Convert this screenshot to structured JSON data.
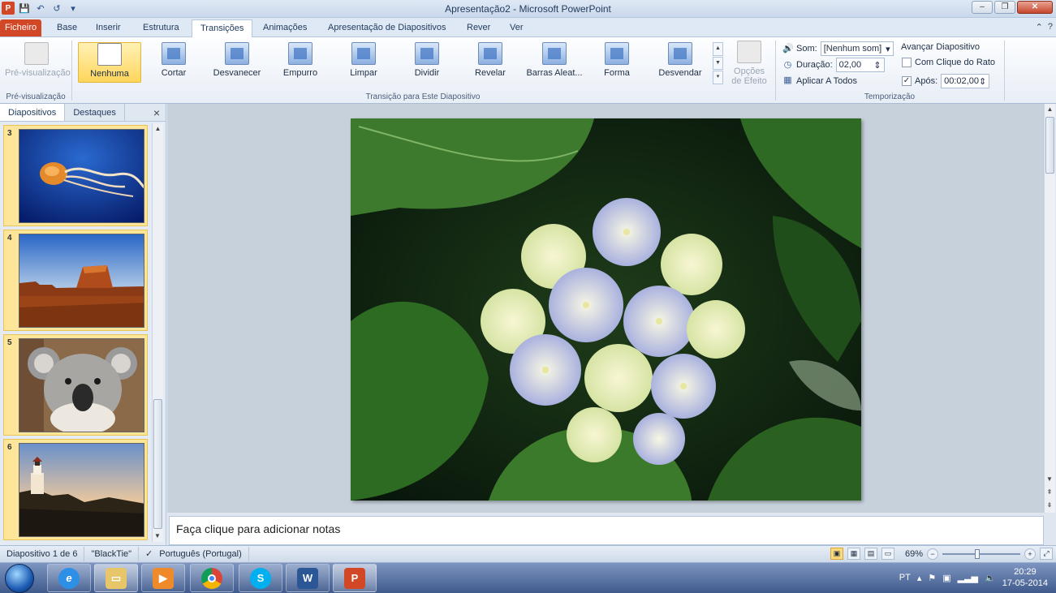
{
  "window": {
    "title": "Apresentação2 - Microsoft PowerPoint",
    "minimize": "–",
    "restore": "❐",
    "close": "✕"
  },
  "quick_access": {
    "app_icon": "P",
    "save_icon": "💾",
    "undo_icon": "↶",
    "repeat_icon": "↺",
    "customize_icon": "▾"
  },
  "tabs": [
    {
      "label": "Ficheiro"
    },
    {
      "label": "Base"
    },
    {
      "label": "Inserir"
    },
    {
      "label": "Estrutura"
    },
    {
      "label": "Transições"
    },
    {
      "label": "Animações"
    },
    {
      "label": "Apresentação de Diapositivos"
    },
    {
      "label": "Rever"
    },
    {
      "label": "Ver"
    }
  ],
  "tab_right": {
    "collapse_icon": "⌃",
    "help_icon": "?"
  },
  "ribbon": {
    "preview": {
      "label": "Pré-visualização",
      "group_label": "Pré-visualização"
    },
    "transitions": [
      {
        "label": "Nenhuma"
      },
      {
        "label": "Cortar"
      },
      {
        "label": "Desvanecer"
      },
      {
        "label": "Empurro"
      },
      {
        "label": "Limpar"
      },
      {
        "label": "Dividir"
      },
      {
        "label": "Revelar"
      },
      {
        "label": "Barras Aleat..."
      },
      {
        "label": "Forma"
      },
      {
        "label": "Desvendar"
      }
    ],
    "transitions_group_label": "Transição para Este Diapositivo",
    "effect_options": {
      "label1": "Opções",
      "label2": "de Efeito"
    },
    "timing": {
      "sound_label": "Som:",
      "sound_value": "[Nenhum som]",
      "duration_label": "Duração:",
      "duration_value": "02,00",
      "apply_all_label": "Aplicar A Todos",
      "advance_title": "Avançar Diapositivo",
      "on_click_label": "Com Clique do Rato",
      "after_label": "Após:",
      "after_value": "00:02,00",
      "group_label": "Temporização"
    }
  },
  "slides_pane": {
    "tab_slides": "Diapositivos",
    "tab_outline": "Destaques",
    "close": "×",
    "thumbs": [
      {
        "num": "3",
        "subject": "jellyfish"
      },
      {
        "num": "4",
        "subject": "desert"
      },
      {
        "num": "5",
        "subject": "koala"
      },
      {
        "num": "6",
        "subject": "lighthouse"
      }
    ]
  },
  "notes": {
    "placeholder": "Faça clique para adicionar notas"
  },
  "status": {
    "slide": "Diapositivo 1 de 6",
    "theme": "\"BlackTie\"",
    "language": "Português (Portugal)",
    "zoom": "69%"
  },
  "taskbar": {
    "language": "PT",
    "time": "20:29",
    "date": "17-05-2014"
  },
  "colors": {
    "file_tab": "#d24726",
    "selected_button": "#ffd65c",
    "ribbon_bg": "#e8eef6"
  }
}
